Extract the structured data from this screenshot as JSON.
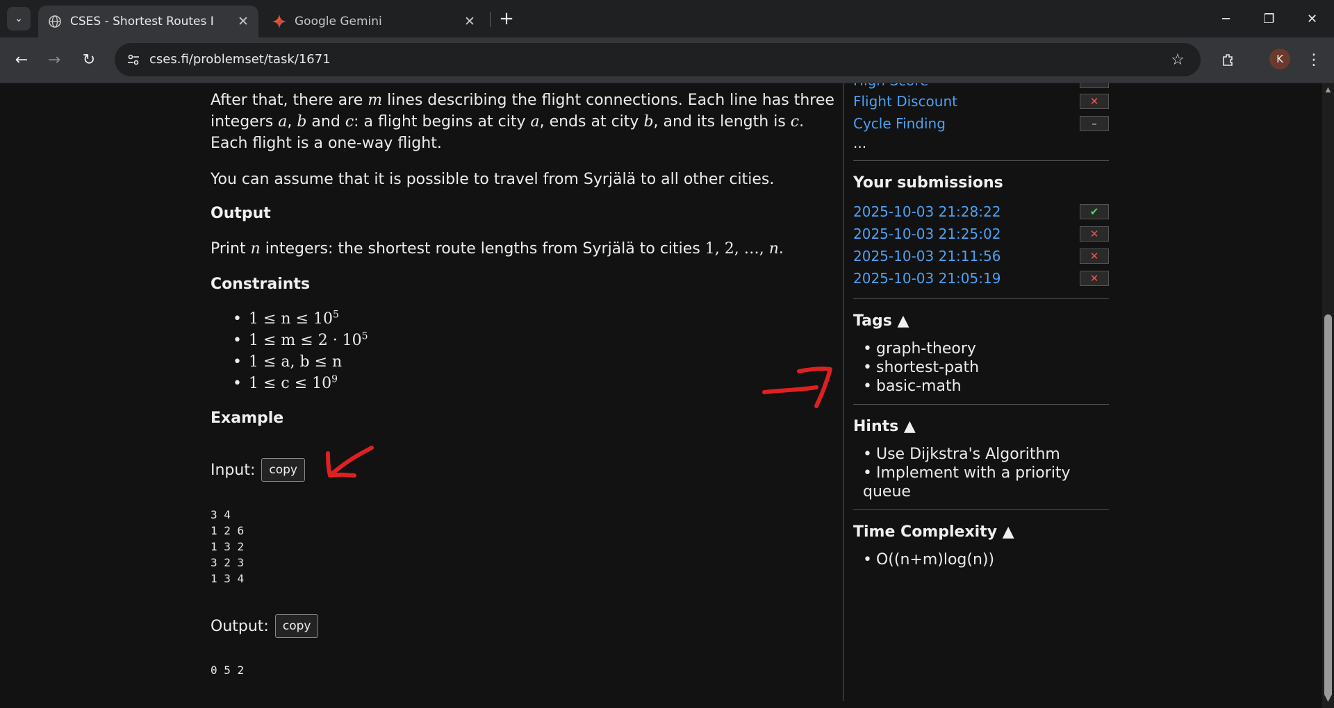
{
  "browser": {
    "tabs": [
      {
        "title": "CSES - Shortest Routes I",
        "active": true,
        "icon": "globe-icon"
      },
      {
        "title": "Google Gemini",
        "active": false,
        "icon": "gemini-icon"
      }
    ],
    "url": "cses.fi/problemset/task/1671",
    "profile_initial": "K"
  },
  "problem": {
    "para1": {
      "t1": "After that, there are ",
      "m": "m",
      "t2": " lines describing the flight connections. Each line has three integers ",
      "a": "a",
      "t3": ", ",
      "b": "b",
      "t4": " and ",
      "c": "c",
      "t5": ": a flight begins at city ",
      "a2": "a",
      "t6": ", ends at city ",
      "b2": "b",
      "t7": ", and its length is ",
      "c2": "c",
      "t8": ". Each flight is a one-way flight."
    },
    "para2": "You can assume that it is possible to travel from Syrjälä to all other cities.",
    "output_heading": "Output",
    "output_text": {
      "t1": "Print ",
      "n": "n",
      "t2": " integers: the shortest route lengths from Syrjälä to cities ",
      "seq": "1, 2, …, ",
      "n2": "n",
      "end": "."
    },
    "constraints_heading": "Constraints",
    "constraints": [
      {
        "expr": "1 ≤ n ≤ 10",
        "sup": "5"
      },
      {
        "expr": "1 ≤ m ≤ 2 · 10",
        "sup": "5"
      },
      {
        "expr": "1 ≤ a, b ≤ n",
        "sup": ""
      },
      {
        "expr": "1 ≤ c ≤ 10",
        "sup": "9"
      }
    ],
    "example_heading": "Example",
    "input_label": "Input:",
    "output_label": "Output:",
    "copy_label": "copy",
    "example_input": "3 4\n1 2 6\n1 3 2\n3 2 3\n1 3 4",
    "example_output": "0 5 2"
  },
  "sidebar": {
    "related": [
      {
        "label": "High Score",
        "status": "none"
      },
      {
        "label": "Flight Discount",
        "status": "fail"
      },
      {
        "label": "Cycle Finding",
        "status": "none"
      }
    ],
    "ellipsis": "...",
    "submissions_heading": "Your submissions",
    "submissions": [
      {
        "time": "2025-10-03 21:28:22",
        "status": "ok"
      },
      {
        "time": "2025-10-03 21:25:02",
        "status": "fail"
      },
      {
        "time": "2025-10-03 21:11:56",
        "status": "fail"
      },
      {
        "time": "2025-10-03 21:05:19",
        "status": "fail"
      }
    ],
    "tags_heading": "Tags ▲",
    "tags": [
      "graph-theory",
      "shortest-path",
      "basic-math"
    ],
    "hints_heading": "Hints ▲",
    "hints": [
      "Use Dijkstra's Algorithm",
      "Implement with a priority queue"
    ],
    "complexity_heading": "Time Complexity ▲",
    "complexity": [
      "O((n+m)log(n))"
    ]
  },
  "colors": {
    "link": "#4ea1f3",
    "annotation": "#e02020",
    "success": "#4cd964",
    "failure": "#ff4d4d"
  }
}
